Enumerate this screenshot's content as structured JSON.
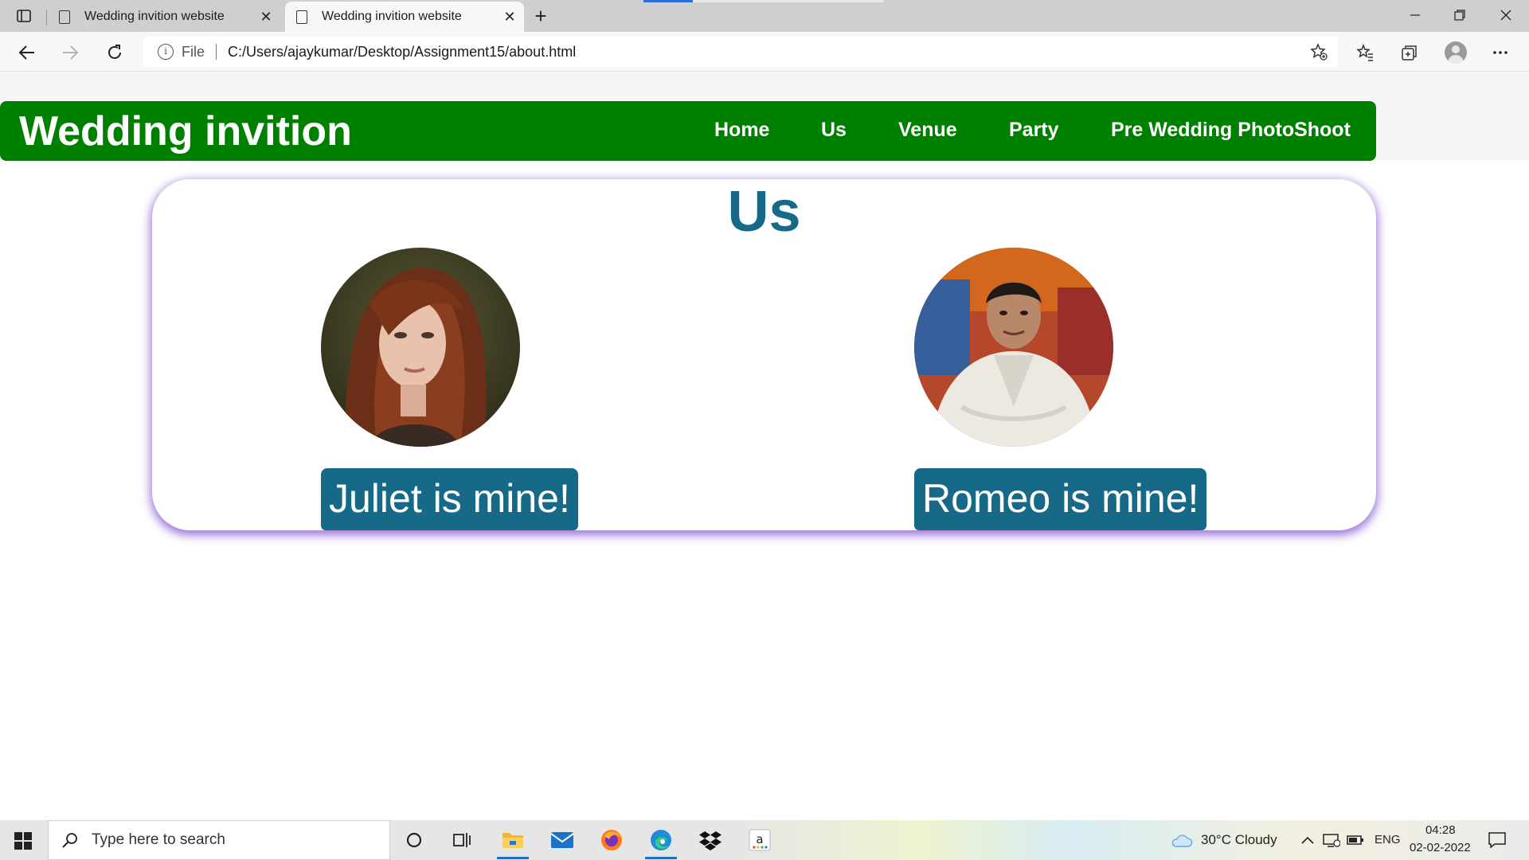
{
  "browser": {
    "tabs": [
      {
        "title": "Wedding invition website",
        "active": false
      },
      {
        "title": "Wedding invition website",
        "active": true
      }
    ],
    "close_glyph": "✕",
    "newtab_glyph": "+",
    "address": {
      "scheme_label": "File",
      "url": "C:/Users/ajaykumar/Desktop/Assignment15/about.html"
    }
  },
  "site": {
    "brand": "Wedding invition",
    "nav": [
      "Home",
      "Us",
      "Venue",
      "Party",
      "Pre Wedding PhotoShoot"
    ],
    "section_title": "Us",
    "captions": {
      "bride": "Juliet is mine!",
      "groom": "Romeo is mine!"
    }
  },
  "taskbar": {
    "search_placeholder": "Type here to search",
    "weather": "30°C  Cloudy",
    "language": "ENG",
    "time": "04:28",
    "date": "02-02-2022"
  },
  "colors": {
    "navbar": "#008000",
    "accent": "#166a87",
    "card_shadow": "#7846c8"
  }
}
